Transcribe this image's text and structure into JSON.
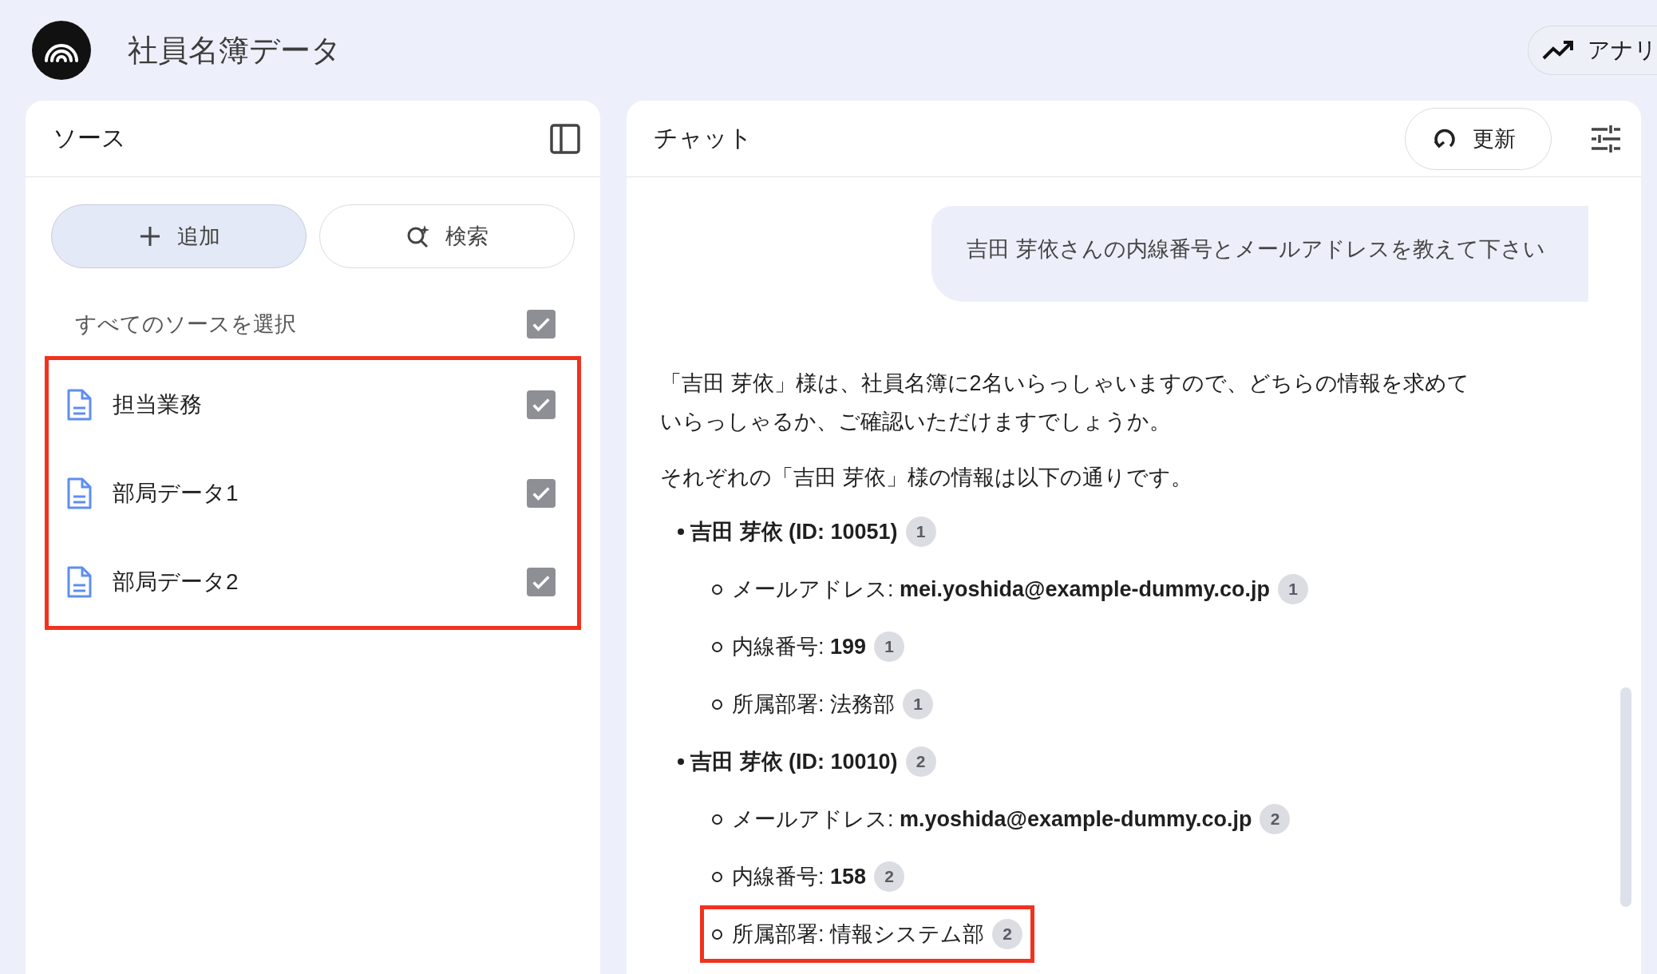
{
  "app": {
    "title": "社員名簿データ",
    "analytics_button": "アナリ"
  },
  "sources": {
    "title": "ソース",
    "add_button": "追加",
    "search_button": "検索",
    "select_all": {
      "label": "すべてのソースを選択",
      "checked": true
    },
    "highlighted": true,
    "items": [
      {
        "label": "担当業務",
        "checked": true
      },
      {
        "label": "部局データ1",
        "checked": true
      },
      {
        "label": "部局データ2",
        "checked": true
      }
    ]
  },
  "chat": {
    "title": "チャット",
    "refresh_button": "更新",
    "user_message": "吉田 芽依さんの内線番号とメールアドレスを教えて下さい",
    "response": {
      "paragraphs": [
        "「吉田 芽依」様は、社員名簿に2名いらっしゃいますので、どちらの情報を求めていらっしゃるか、ご確認いただけますでしょうか。",
        "それぞれの「吉田 芽依」様の情報は以下の通りです。"
      ],
      "people": [
        {
          "heading": "吉田 芽依 (ID: 10051)",
          "citation": "1",
          "details": [
            {
              "text": "メールアドレス: **mei.yoshida@example-dummy.co.jp**",
              "citation": "1",
              "highlighted": false
            },
            {
              "text": "内線番号: **199**",
              "citation": "1",
              "highlighted": false
            },
            {
              "text": "所属部署: 法務部",
              "citation": "1",
              "highlighted": false
            }
          ]
        },
        {
          "heading": "吉田 芽依 (ID: 10010)",
          "citation": "2",
          "details": [
            {
              "text": "メールアドレス: **m.yoshida@example-dummy.co.jp**",
              "citation": "2",
              "highlighted": false
            },
            {
              "text": "内線番号: **158**",
              "citation": "2",
              "highlighted": false
            },
            {
              "text": "所属部署: 情報システム部",
              "citation": "2",
              "highlighted": true
            }
          ]
        }
      ]
    }
  }
}
